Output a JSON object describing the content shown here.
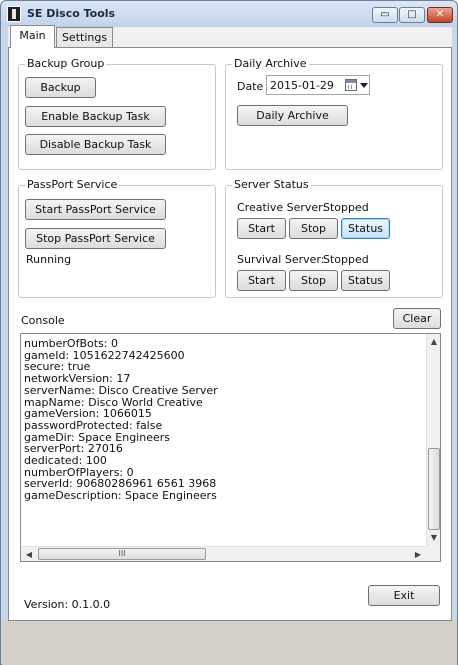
{
  "window": {
    "title": "SE Disco Tools",
    "minimize_glyph": "▭",
    "maximize_glyph": "□",
    "close_glyph": "✕"
  },
  "tabs": [
    {
      "label": "Main",
      "active": true
    },
    {
      "label": "Settings",
      "active": false
    }
  ],
  "backup_group": {
    "label": "Backup Group",
    "backup_button": "Backup",
    "enable_button": "Enable Backup Task",
    "disable_button": "Disable Backup Task"
  },
  "daily_archive": {
    "label": "Daily Archive",
    "date_label": "Date",
    "date_value": "2015-01-29",
    "archive_button": "Daily Archive"
  },
  "passport_service": {
    "label": "PassPort Service",
    "start_button": "Start PassPort Service",
    "stop_button": "Stop PassPort Service",
    "status_text": "Running"
  },
  "server_status": {
    "label": "Server Status",
    "creative": {
      "label": "Creative Server:",
      "status": "Stopped",
      "start_button": "Start",
      "stop_button": "Stop",
      "status_button": "Status"
    },
    "survival": {
      "label": "Survival Server:",
      "status": "Stopped",
      "start_button": "Start",
      "stop_button": "Stop",
      "status_button": "Status"
    }
  },
  "console": {
    "label": "Console",
    "clear_button": "Clear",
    "lines": [
      "numberOfBots: 0",
      "gameId: 1051622742425600",
      "secure: true",
      "networkVersion: 17",
      "serverName: Disco Creative Server",
      "mapName: Disco World Creative",
      "gameVersion: 1066015",
      "passwordProtected: false",
      "gameDir: Space Engineers",
      "serverPort: 27016",
      "dedicated: 100",
      "numberOfPlayers: 0",
      "serverId: 90680286961 6561 3968",
      "gameDescription: Space Engineers"
    ],
    "hscroll_grip": "III"
  },
  "footer": {
    "version_text": "Version: 0.1.0.0",
    "exit_button": "Exit"
  }
}
